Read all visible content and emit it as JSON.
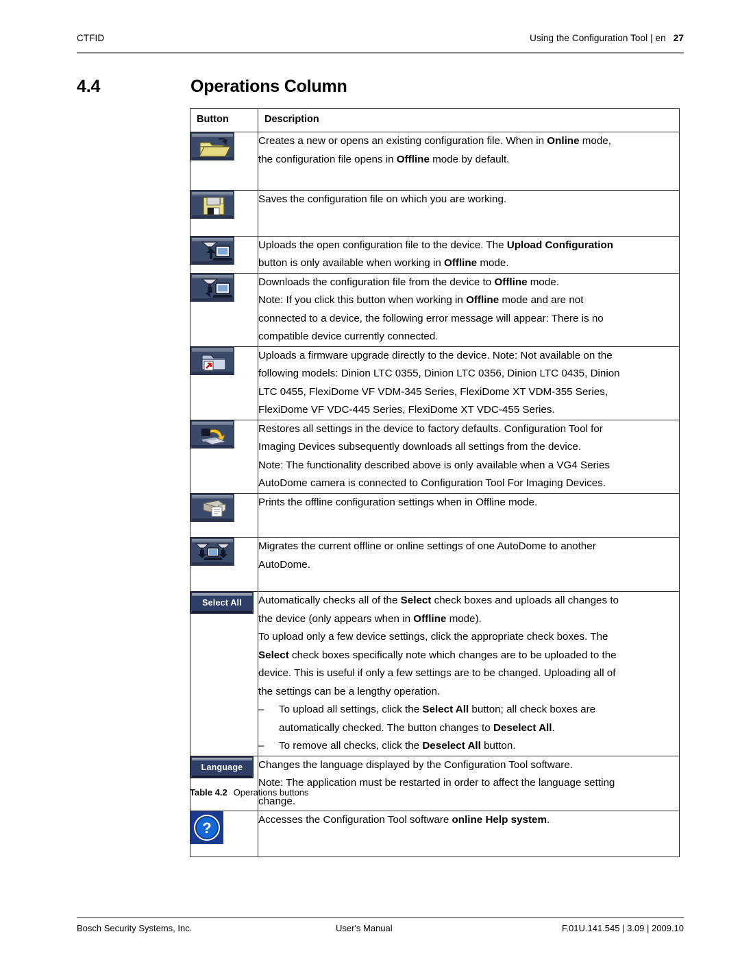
{
  "header": {
    "left": "CTFID",
    "right": "Using the Configuration Tool | en",
    "page_number": "27",
    "rule_color": "#8a8a8a"
  },
  "section": {
    "number": "4.4",
    "title": "Operations Column"
  },
  "table": {
    "columns": [
      "Button",
      "Description"
    ],
    "caption_label": "Table 4.2",
    "caption_text": "Operations buttons",
    "button_colors": {
      "face": "#3c4a69",
      "label_face": "#2f3e66",
      "bevel_light": "#9aa3b4",
      "bevel_dark": "#2a3350",
      "folder_yellow": "#e8e08a",
      "help_blue": "#1a3a8f"
    },
    "rows": [
      {
        "icon": "open-file-icon",
        "icon_kind": "glyph",
        "lines": [
          [
            {
              "t": "Creates a new or opens an existing configuration file. When in ",
              "b": false
            },
            {
              "t": "Online",
              "b": true
            },
            {
              "t": " mode,",
              "b": false
            }
          ],
          [
            {
              "t": "the configuration file opens in ",
              "b": false
            },
            {
              "t": "Offline",
              "b": true
            },
            {
              "t": " mode by default.",
              "b": false
            }
          ]
        ]
      },
      {
        "icon": "save-floppy-icon",
        "icon_kind": "glyph",
        "lines": [
          [
            {
              "t": "Saves the configuration file on which you are working.",
              "b": false
            }
          ]
        ]
      },
      {
        "icon": "upload-configuration-icon",
        "icon_kind": "glyph",
        "lines": [
          [
            {
              "t": "Uploads the open configuration file to the device. The ",
              "b": false
            },
            {
              "t": "Upload Configuration",
              "b": true
            }
          ],
          [
            {
              "t": "button is only available when working in ",
              "b": false
            },
            {
              "t": "Offline",
              "b": true
            },
            {
              "t": " mode.",
              "b": false
            }
          ]
        ]
      },
      {
        "icon": "download-configuration-icon",
        "icon_kind": "glyph",
        "lines": [
          [
            {
              "t": "Downloads the configuration file from the device to ",
              "b": false
            },
            {
              "t": "Offline",
              "b": true
            },
            {
              "t": " mode.",
              "b": false
            }
          ],
          [
            {
              "t": "Note: If you click this button when working in ",
              "b": false
            },
            {
              "t": "Offline",
              "b": true
            },
            {
              "t": " mode and are not",
              "b": false
            }
          ],
          [
            {
              "t": "connected to a device, the following error message will appear: There is no",
              "b": false
            }
          ],
          [
            {
              "t": "compatible device currently connected.",
              "b": false
            }
          ]
        ]
      },
      {
        "icon": "firmware-upload-icon",
        "icon_kind": "glyph",
        "lines": [
          [
            {
              "t": "Uploads a firmware upgrade directly to the device. Note: Not available on the",
              "b": false
            }
          ],
          [
            {
              "t": "following models: Dinion LTC 0355, Dinion LTC 0356, Dinion LTC 0435, Dinion",
              "b": false
            }
          ],
          [
            {
              "t": "LTC 0455, FlexiDome VF VDM-345 Series, FlexiDome XT VDM-355 Series,",
              "b": false
            }
          ],
          [
            {
              "t": "FlexiDome VF VDC-445 Series, FlexiDome XT VDC-455 Series.",
              "b": false
            }
          ]
        ]
      },
      {
        "icon": "restore-defaults-icon",
        "icon_kind": "glyph",
        "lines": [
          [
            {
              "t": "Restores all settings in the device to factory defaults. Configuration Tool for",
              "b": false
            }
          ],
          [
            {
              "t": "Imaging Devices subsequently downloads all settings from the device.",
              "b": false
            }
          ],
          [
            {
              "t": "Note: The functionality described above is only available when a VG4 Series",
              "b": false
            }
          ],
          [
            {
              "t": "AutoDome camera is connected to Configuration Tool For Imaging Devices.",
              "b": false
            }
          ]
        ]
      },
      {
        "icon": "print-icon",
        "icon_kind": "glyph",
        "lines": [
          [
            {
              "t": "Prints the offline configuration settings when in Offline mode.",
              "b": false
            }
          ]
        ]
      },
      {
        "icon": "migrate-settings-icon",
        "icon_kind": "glyph",
        "lines": [
          [
            {
              "t": "Migrates the current offline or online settings of one AutoDome to another",
              "b": false
            }
          ],
          [
            {
              "t": "AutoDome.",
              "b": false
            }
          ]
        ]
      },
      {
        "icon": "select-all-button",
        "icon_kind": "label",
        "icon_label": "Select All",
        "lines": [
          [
            {
              "t": "Automatically checks all of the ",
              "b": false
            },
            {
              "t": "Select",
              "b": true
            },
            {
              "t": " check boxes and uploads all changes to",
              "b": false
            }
          ],
          [
            {
              "t": "the device (only appears when in ",
              "b": false
            },
            {
              "t": "Offline",
              "b": true
            },
            {
              "t": " mode).",
              "b": false
            }
          ],
          [
            {
              "t": "To upload only a few device settings, click the appropriate check boxes. The",
              "b": false
            }
          ],
          [
            {
              "t": "Select",
              "b": true
            },
            {
              "t": " check boxes specifically note which changes are to be uploaded to the",
              "b": false
            }
          ],
          [
            {
              "t": "device. This is useful if only a few settings are to be changed. Uploading all of",
              "b": false
            }
          ],
          [
            {
              "t": "the settings can be a lengthy operation.",
              "b": false
            }
          ]
        ],
        "dashes": [
          {
            "dash": "–",
            "lines": [
              [
                {
                  "t": "To upload all settings, click the ",
                  "b": false
                },
                {
                  "t": "Select All",
                  "b": true
                },
                {
                  "t": " button; all check boxes are",
                  "b": false
                }
              ],
              [
                {
                  "t": "automatically checked. The button changes to ",
                  "b": false
                },
                {
                  "t": "Deselect All",
                  "b": true
                },
                {
                  "t": ".",
                  "b": false
                }
              ]
            ]
          },
          {
            "dash": "–",
            "lines": [
              [
                {
                  "t": "To remove all checks, click the ",
                  "b": false
                },
                {
                  "t": "Deselect All",
                  "b": true
                },
                {
                  "t": " button.",
                  "b": false
                }
              ]
            ]
          }
        ]
      },
      {
        "icon": "language-button",
        "icon_kind": "label",
        "icon_label": "Language",
        "lines": [
          [
            {
              "t": "Changes the language displayed by the Configuration Tool software.",
              "b": false
            }
          ],
          [
            {
              "t": "Note: The application must be restarted in order to affect the language setting",
              "b": false
            }
          ],
          [
            {
              "t": "change.",
              "b": false
            }
          ]
        ]
      },
      {
        "icon": "help-icon",
        "icon_kind": "help",
        "lines": [
          [
            {
              "t": "Accesses the Configuration Tool software ",
              "b": false
            },
            {
              "t": "online Help system",
              "b": true
            },
            {
              "t": ".",
              "b": false
            }
          ]
        ]
      }
    ]
  },
  "footer": {
    "left": "Bosch Security Systems, Inc.",
    "middle": "User's Manual",
    "right": "F.01U.141.545 | 3.09 | 2009.10"
  }
}
